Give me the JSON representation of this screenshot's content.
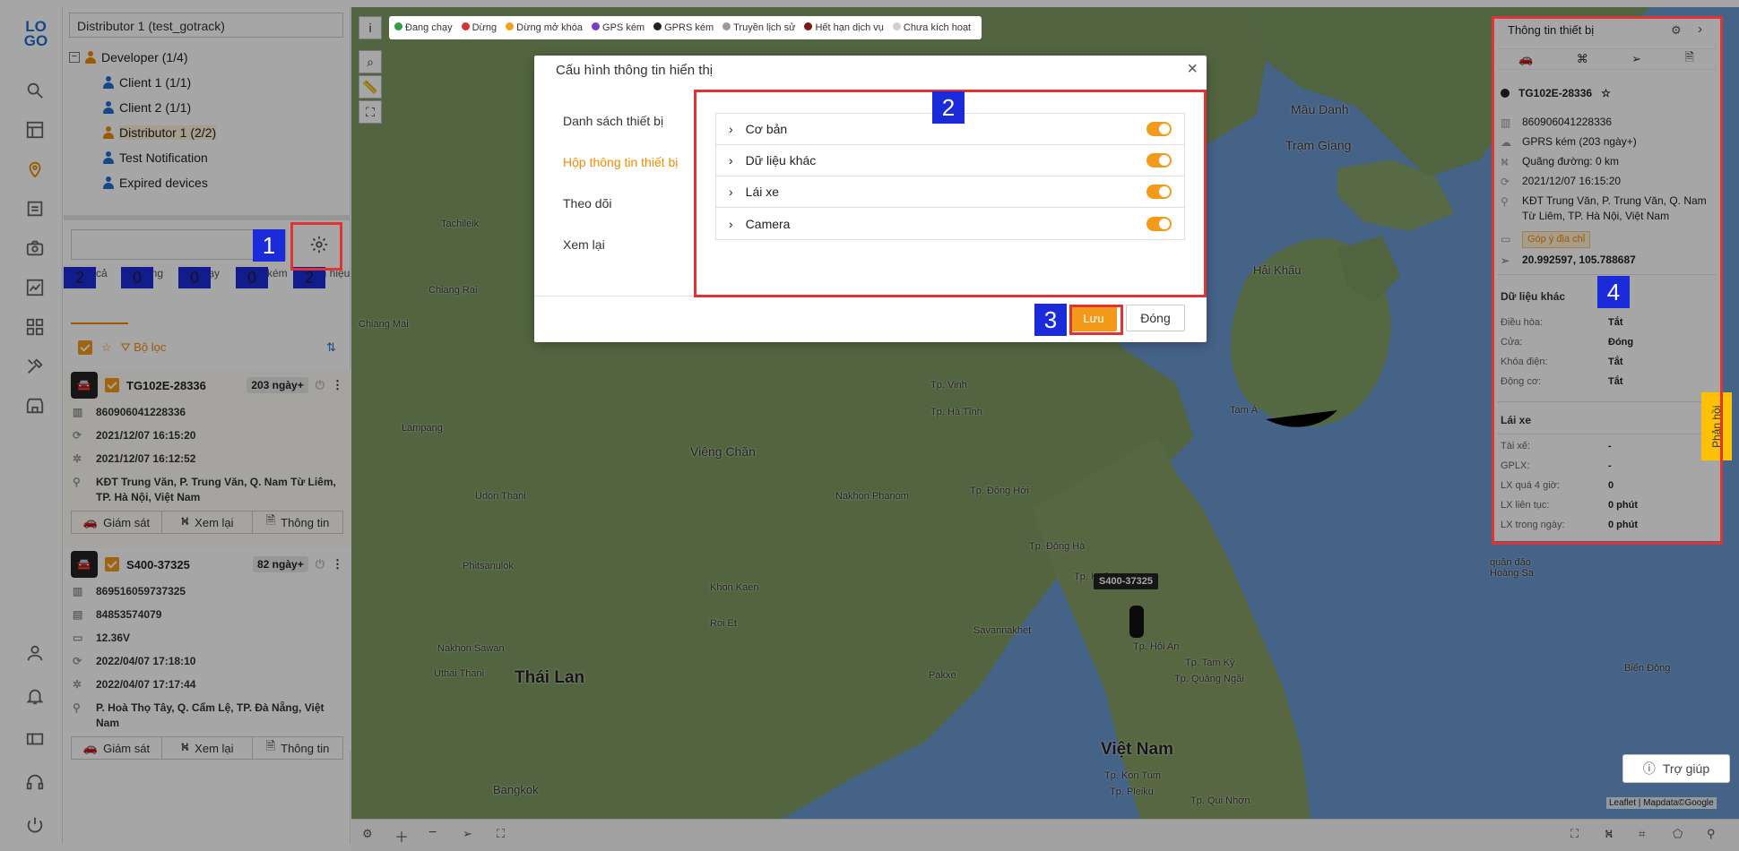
{
  "nav": {
    "logo": "LOGO"
  },
  "left_panel": {
    "distributor_select": "Distributor 1 (test_gotrack)",
    "tree": [
      {
        "label": "Developer (1/4)",
        "level": 0
      },
      {
        "label": "Client 1 (1/1)",
        "level": 1
      },
      {
        "label": "Client 2 (1/1)",
        "level": 1
      },
      {
        "label": "Distributor 1 (2/2)",
        "level": 1
      },
      {
        "label": "Test Notification",
        "level": 1
      },
      {
        "label": "Expired devices",
        "level": 1
      }
    ],
    "stats": [
      {
        "count": "2",
        "label": "Tất cả"
      },
      {
        "count": "0",
        "label": "Dừng"
      },
      {
        "count": "0",
        "label": "Chạy"
      },
      {
        "count": "0",
        "label": "GPS kém"
      },
      {
        "count": "2",
        "label": "Mất tín hiệu"
      }
    ],
    "filter_label": "Bộ lọc",
    "devices": [
      {
        "plate": "TG102E-28336",
        "badge": "203 ngày+",
        "imei": "860906041228336",
        "time1": "2021/12/07 16:15:20",
        "time2": "2021/12/07 16:12:52",
        "address": "KĐT Trung Văn, P. Trung Văn, Q. Nam Từ Liêm, TP. Hà Nội, Việt Nam"
      },
      {
        "plate": "S400-37325",
        "badge": "82 ngày+",
        "imei": "869516059737325",
        "phone": "84853574079",
        "voltage": "12.36V",
        "time1": "2022/04/07 17:18:10",
        "time2": "2022/04/07 17:17:44",
        "address": "P. Hoà Thọ Tây, Q. Cẩm Lệ, TP. Đà Nẵng, Việt Nam"
      }
    ],
    "actions": {
      "monitor": "Giám sát",
      "replay": "Xem lại",
      "info": "Thông tin"
    }
  },
  "map": {
    "legend": [
      {
        "label": "Đang chạy",
        "color": "#2e9e3e"
      },
      {
        "label": "Dừng",
        "color": "#d93030"
      },
      {
        "label": "Dừng mở khóa",
        "color": "#f2a21a"
      },
      {
        "label": "GPS kém",
        "color": "#7a3cc2"
      },
      {
        "label": "GPRS kém",
        "color": "#222222"
      },
      {
        "label": "Truyền lịch sử",
        "color": "#9a9a9a"
      },
      {
        "label": "Hết hạn dịch vụ",
        "color": "#7a1a1a"
      },
      {
        "label": "Chưa kích hoạt",
        "color": "#cfcfcf"
      }
    ],
    "places": [
      {
        "name": "Thái Lan",
        "big": true
      },
      {
        "name": "Việt Nam",
        "big": true
      },
      {
        "name": "Viêng Chăn",
        "big": false
      },
      {
        "name": "Mâu Danh",
        "big": false
      },
      {
        "name": "Trạm Giang",
        "big": false
      },
      {
        "name": "Hải Khẩu",
        "big": false
      },
      {
        "name": "Tam Á",
        "big": false
      },
      {
        "name": "Bangkok",
        "big": false
      },
      {
        "name": "Tp. Vinh",
        "big": false
      },
      {
        "name": "Tp. Hà Tĩnh",
        "big": false
      },
      {
        "name": "Tp. Đông Hới",
        "big": false
      },
      {
        "name": "Tp. Đông Hà",
        "big": false
      },
      {
        "name": "Tp. Huế",
        "big": false
      },
      {
        "name": "Tp. Hội An",
        "big": false
      },
      {
        "name": "Tp. Tam Kỳ",
        "big": false
      },
      {
        "name": "Tp. Quảng Ngãi",
        "big": false
      },
      {
        "name": "Tp. Kon Tum",
        "big": false
      },
      {
        "name": "Tp. Pleiku",
        "big": false
      },
      {
        "name": "Tp. Qui Nhơn",
        "big": false
      },
      {
        "name": "Biển Đông",
        "big": false
      },
      {
        "name": "quần đảo Hoàng Sa",
        "big": false
      },
      {
        "name": "Pakxe",
        "big": false
      },
      {
        "name": "Savannakhet",
        "big": false
      },
      {
        "name": "Nakhon Phanom",
        "big": false
      },
      {
        "name": "Udon Thani",
        "big": false
      },
      {
        "name": "Khon Kaen",
        "big": false
      },
      {
        "name": "Roi Et",
        "big": false
      },
      {
        "name": "Chiang Mai",
        "big": false
      },
      {
        "name": "Chiang Rai",
        "big": false
      },
      {
        "name": "Lampang",
        "big": false
      },
      {
        "name": "Phitsanulok",
        "big": false
      },
      {
        "name": "Nakhon Sawan",
        "big": false
      },
      {
        "name": "Uthai Thani",
        "big": false
      },
      {
        "name": "Tachileik",
        "big": false
      }
    ],
    "marker_label": "S400-37325",
    "attribution": "Leaflet | Mapdata©Google",
    "help_label": "Trợ giúp",
    "feedback_label": "Phản hồi"
  },
  "modal": {
    "title": "Cấu hình thông tin hiển thị",
    "tabs": [
      "Danh sách thiết bị",
      "Hộp thông tin thiết bị",
      "Theo dõi",
      "Xem lại"
    ],
    "active_tab": 1,
    "rows": [
      {
        "label": "Cơ bản",
        "enabled": true
      },
      {
        "label": "Dữ liệu khác",
        "enabled": true
      },
      {
        "label": "Lái xe",
        "enabled": true
      },
      {
        "label": "Camera",
        "enabled": true
      }
    ],
    "save": "Lưu",
    "close": "Đóng"
  },
  "info_panel": {
    "title": "Thông tin thiết bị",
    "plate": "TG102E-28336",
    "imei": "860906041228336",
    "status": "GPRS kém (203 ngày+)",
    "distance": "Quãng đường: 0 km",
    "time": "2021/12/07 16:15:20",
    "address": "KĐT Trung Văn, P. Trung Văn, Q. Nam Từ Liêm, TP. Hà Nội, Việt Nam",
    "suggest_address": "Góp ý địa chỉ",
    "coords": "20.992597, 105.788687",
    "other_section": "Dữ liệu khác",
    "other": [
      {
        "k": "Điều hòa:",
        "v": "Tắt"
      },
      {
        "k": "Cửa:",
        "v": "Đóng"
      },
      {
        "k": "Khóa điện:",
        "v": "Tắt"
      },
      {
        "k": "Động cơ:",
        "v": "Tắt"
      }
    ],
    "driver_section": "Lái xe",
    "driver": [
      {
        "k": "Tài xế:",
        "v": "-"
      },
      {
        "k": "GPLX:",
        "v": "-"
      },
      {
        "k": "LX quá 4 giờ:",
        "v": "0"
      },
      {
        "k": "LX liên tục:",
        "v": "0 phút"
      },
      {
        "k": "LX trong ngày:",
        "v": "0 phút"
      }
    ]
  },
  "callouts": [
    "1",
    "2",
    "3",
    "4"
  ]
}
